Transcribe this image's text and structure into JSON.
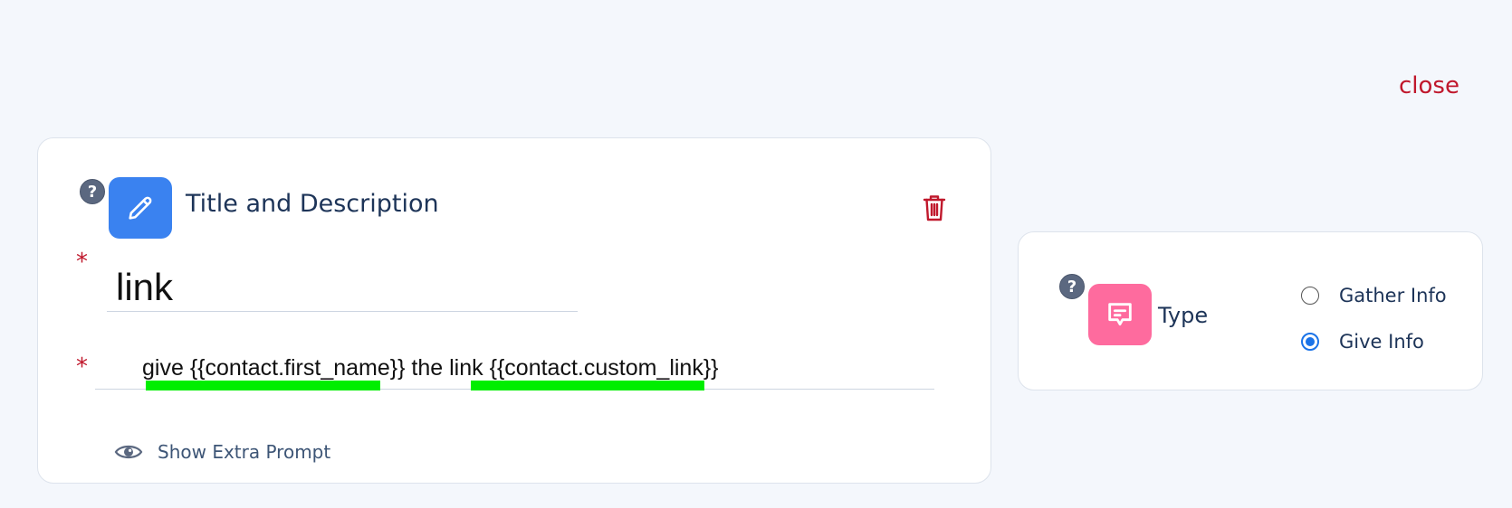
{
  "header": {
    "close_label": "close"
  },
  "step_card": {
    "section_title": "Title and Description",
    "required_mark": "*",
    "title_value": "link",
    "description": {
      "part1": "give ",
      "var1": "{{contact.first_name}}",
      "part2": " the link ",
      "var2": "{{contact.custom_link}}"
    },
    "extra_prompt_label": "Show Extra Prompt",
    "help_mark": "?"
  },
  "type_card": {
    "label": "Type",
    "help_mark": "?",
    "options": [
      {
        "label": "Gather Info",
        "selected": false
      },
      {
        "label": "Give Info",
        "selected": true
      }
    ]
  },
  "colors": {
    "background": "#f4f7fc",
    "close": "#c0182c",
    "accent_blue": "#3a82f0",
    "accent_pink": "#fe6b9e",
    "highlight": "#00ee00",
    "radio_selected": "#1a73e8"
  },
  "icons": {
    "step_icon": "pencil-icon",
    "type_icon": "chat-bubble-icon",
    "delete_icon": "trash-icon",
    "extra_prompt_icon": "eye-icon"
  }
}
